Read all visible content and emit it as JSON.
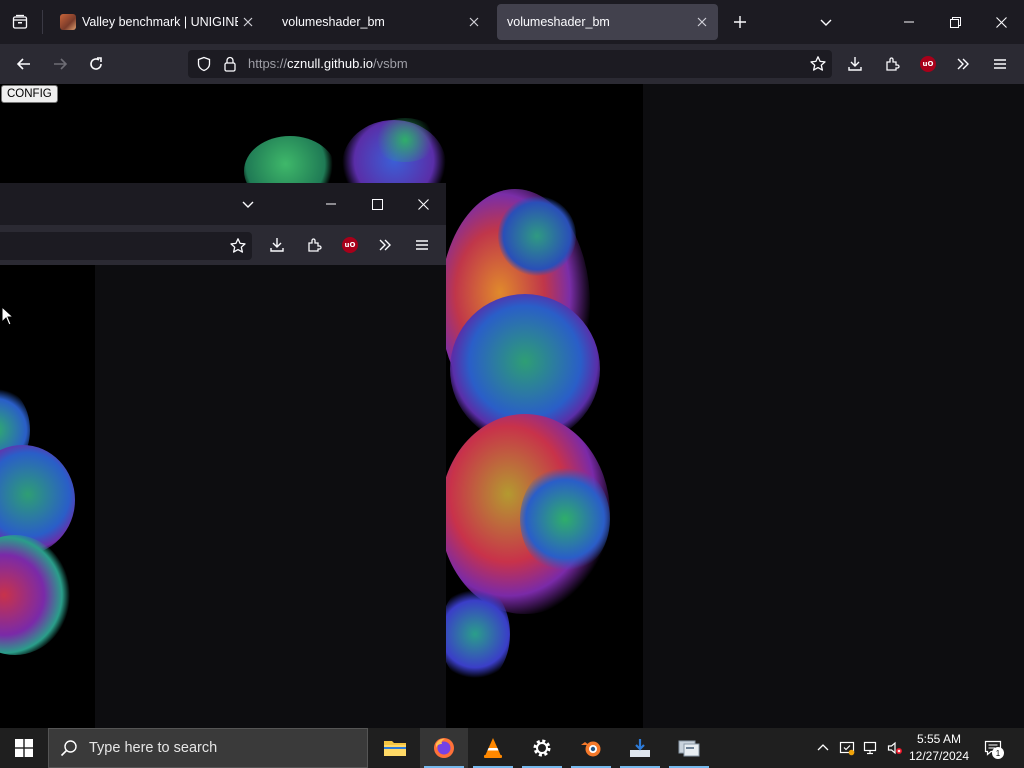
{
  "browser": {
    "tabs": [
      {
        "title": "Valley benchmark | UNIGINE Be",
        "favicon": "unigine-favicon",
        "active": false
      },
      {
        "title": "volumeshader_bm",
        "active": false
      },
      {
        "title": "volumeshader_bm",
        "active": true
      }
    ],
    "url_prefix": "https://",
    "url_host": "cznull.github.io",
    "url_path": "/vsbm"
  },
  "page": {
    "config_button": "CONFIG"
  },
  "taskbar": {
    "search_placeholder": "Type here to search",
    "apps": [
      "file-explorer",
      "firefox",
      "vlc",
      "settings",
      "blender",
      "installer",
      "system-tool"
    ],
    "time": "5:55 AM",
    "date": "12/27/2024",
    "notification_count": "1"
  },
  "colors": {
    "tabstrip": "#1c1b22",
    "navbar": "#2b2a33",
    "active_tab": "#42414d",
    "taskbar": "#1f1f1f"
  }
}
